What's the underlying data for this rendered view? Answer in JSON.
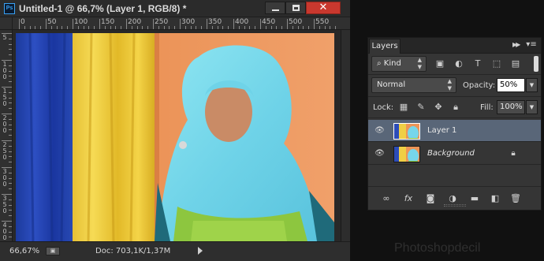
{
  "app": {
    "logo": "Ps"
  },
  "document": {
    "title": "Untitled-1 @ 66,7% (Layer 1, RGB/8) *",
    "ruler_h_labels": [
      "0",
      "50",
      "100",
      "150",
      "200",
      "250",
      "300",
      "350",
      "400",
      "450",
      "500",
      "550"
    ],
    "ruler_v_labels": [
      "5",
      "100",
      "150",
      "200",
      "250",
      "300",
      "350",
      "400"
    ],
    "zoom": "66,67%",
    "doc_info": "Doc: 703,1K/1,37M"
  },
  "layers_panel": {
    "tab": "Layers",
    "filter_kind": "Kind",
    "blend_mode": "Normal",
    "opacity_label": "Opacity:",
    "opacity_value": "50%",
    "lock_label": "Lock:",
    "fill_label": "Fill:",
    "fill_value": "100%",
    "layers": [
      {
        "name": "Layer 1",
        "selected": true
      },
      {
        "name": "Background",
        "selected": false,
        "locked": true
      }
    ]
  },
  "icons": {
    "filter": [
      "image-filter-icon",
      "adjustment-filter-icon",
      "type-filter-icon",
      "shape-filter-icon",
      "smart-object-filter-icon"
    ],
    "lock": [
      "lock-transparent-icon",
      "lock-image-icon",
      "lock-position-icon",
      "lock-all-icon"
    ],
    "footer": [
      "link-layers-icon",
      "fx-icon",
      "add-mask-icon",
      "new-adjustment-icon",
      "new-group-icon",
      "new-layer-icon",
      "delete-layer-icon"
    ]
  },
  "watermark": "Photoshopdecil"
}
